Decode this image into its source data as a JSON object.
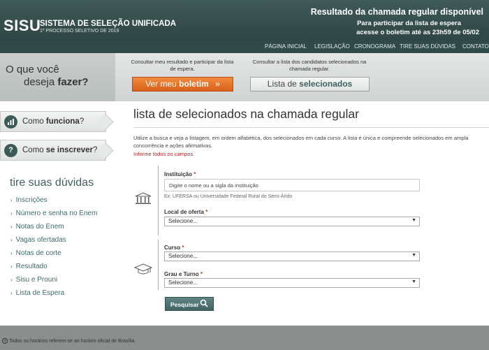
{
  "header": {
    "logo": "SISU",
    "title": "SISTEMA DE SELEÇÃO UNIFICADA",
    "subtitle": "1º PROCESSO SELETIVO DE 2019",
    "notice_title": "Resultado da chamada regular disponível",
    "notice_line2": "Para participar da lista de espera",
    "notice_line3": "acesse o boletim até as 23h59 de 05/02"
  },
  "nav": [
    "PÁGINA INICIAL",
    "LEGISLAÇÃO",
    "CRONOGRAMA",
    "TIRE SUAS DÚVIDAS",
    "CONTATO"
  ],
  "action": {
    "question_line1": "O que você",
    "question_line2": "deseja",
    "question_bold": "fazer?",
    "desc_boletim": "Consultar meu resultado e participar da lista de espera.",
    "desc_selecionados": "Consultar a lista dos candidatos selecionados na chamada regular.",
    "btn_boletim_prefix": "Ver meu",
    "btn_boletim_bold": "boletim",
    "btn_boletim_arrow": "»",
    "btn_sel_prefix": "Lista de",
    "btn_sel_bold": "selecionados"
  },
  "sidebar": {
    "como_funciona_prefix": "Como",
    "como_funciona_bold": "funciona",
    "como_funciona_suffix": "?",
    "como_inscrever_prefix": "Como",
    "como_inscrever_bold": "se inscrever",
    "como_inscrever_suffix": "?",
    "duvidas_title": "tire suas dúvidas",
    "links": [
      "Inscrições",
      "Número e senha no Enem",
      "Notas do Enem",
      "Vagas ofertadas",
      "Notas de corte",
      "Resultado",
      "Sisu e Prouni",
      "Lista de Espera"
    ]
  },
  "main": {
    "title": "lista de selecionados na chamada regular",
    "intro": "Utilize a busca e veja a listagem, em ordem alfabética, dos selecionados em cada curso. A lista é única e compreende selecionados em ampla concorrência e ações afirmativas.",
    "required_note": "Informe todos os campos.",
    "instituicao_label": "Instituição",
    "instituicao_placeholder": "Digite o nome ou a sigla da instituição",
    "instituicao_hint": "Ex: UFERSA ou Universidade Federal Rural do Semi-Árido",
    "local_label": "Local de oferta",
    "local_value": "Selecione...",
    "curso_label": "Curso",
    "curso_value": "Selecione...",
    "grau_label": "Grau e Turno",
    "grau_value": "Selecione...",
    "required_mark": "*",
    "search_button": "Pesquisar"
  },
  "footer": {
    "note": "Todos os horários referem-se ao horário oficial de Brasília."
  }
}
